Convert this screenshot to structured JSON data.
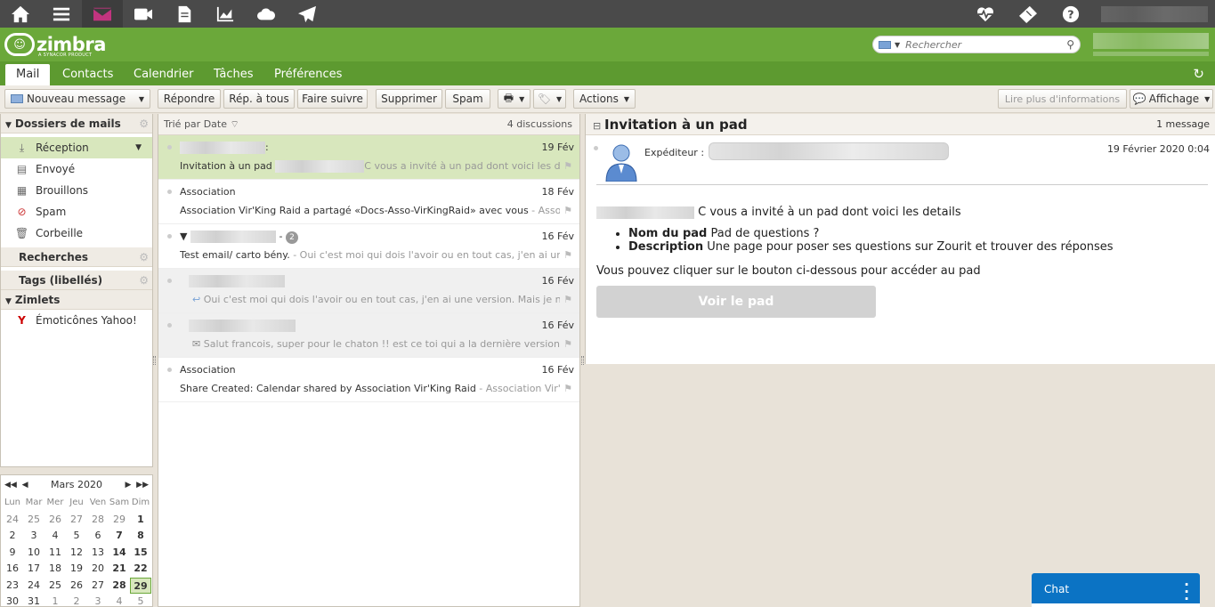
{
  "search": {
    "placeholder": "Rechercher"
  },
  "tabs": [
    {
      "label": "Mail"
    },
    {
      "label": "Contacts"
    },
    {
      "label": "Calendrier"
    },
    {
      "label": "Tâches"
    },
    {
      "label": "Préférences"
    }
  ],
  "toolbar": {
    "new_message": "Nouveau message",
    "reply": "Répondre",
    "reply_all": "Rép. à tous",
    "forward": "Faire suivre",
    "delete": "Supprimer",
    "spam": "Spam",
    "actions": "Actions",
    "read_more": "Lire plus d'informations",
    "view": "Affichage"
  },
  "sidebar": {
    "mail_folders": "Dossiers de mails",
    "folders": [
      {
        "label": "Réception"
      },
      {
        "label": "Envoyé"
      },
      {
        "label": "Brouillons"
      },
      {
        "label": "Spam"
      },
      {
        "label": "Corbeille"
      }
    ],
    "searches": "Recherches",
    "tags": "Tags (libellés)",
    "zimlets": "Zimlets",
    "zimlet_item": "Émoticônes Yahoo!"
  },
  "calendar": {
    "month": "Mars 2020",
    "dow": [
      "Lun",
      "Mar",
      "Mer",
      "Jeu",
      "Ven",
      "Sam",
      "Dim"
    ],
    "weeks": [
      [
        "24",
        "25",
        "26",
        "27",
        "28",
        "29",
        "1"
      ],
      [
        "2",
        "3",
        "4",
        "5",
        "6",
        "7",
        "8"
      ],
      [
        "9",
        "10",
        "11",
        "12",
        "13",
        "14",
        "15"
      ],
      [
        "16",
        "17",
        "18",
        "19",
        "20",
        "21",
        "22"
      ],
      [
        "23",
        "24",
        "25",
        "26",
        "27",
        "28",
        "29"
      ],
      [
        "30",
        "31",
        "1",
        "2",
        "3",
        "4",
        "5"
      ]
    ]
  },
  "list": {
    "sort": "Trié par Date",
    "count": "4 discussions",
    "messages": [
      {
        "from": "",
        "date": "19 Fév",
        "subject": "Invitation à un pad",
        "fragment": "C vous a invité à un pad dont voici les de"
      },
      {
        "from": "Association",
        "date": "18 Fév",
        "subject": "Association Vir'King Raid a partagé «Docs-Asso-VirKingRaid» avec vous",
        "fragment": " - Asso"
      },
      {
        "from": "- ",
        "date": "16 Fév",
        "subject": "Test email/ carto bény.",
        "fragment": " - Oui c'est moi qui dois l'avoir ou en tout cas, j'en ai une"
      },
      {
        "from": "",
        "date": "16 Fév",
        "subject": "",
        "fragment": "Oui c'est moi qui dois l'avoir ou en tout cas, j'en ai une version. Mais je n"
      },
      {
        "from": "",
        "date": "16 Fév",
        "subject": "",
        "fragment": "Salut francois, super pour le chaton !! est ce toi qui a la dernière version"
      },
      {
        "from": "Association",
        "date": "16 Fév",
        "subject": "Share Created: Calendar shared by Association Vir'King Raid",
        "fragment": " - Association Vir'K"
      }
    ],
    "thread_count": "2"
  },
  "reading": {
    "title": "Invitation à un pad",
    "msg_count": "1 message",
    "sender_label": "Expéditeur :",
    "date": "19 Février 2020 0:04",
    "intro": "C vous a invité à un pad dont voici les details",
    "items": [
      {
        "key": "Nom du pad",
        "value": " Pad de questions ?"
      },
      {
        "key": "Description",
        "value": " Une page pour poser ses questions sur Zourit et trouver des réponses"
      }
    ],
    "instruction": "Vous pouvez cliquer sur le bouton ci-dessous pour accéder au pad",
    "button": "Voir le pad"
  },
  "chat": {
    "label": "Chat"
  },
  "colors": {
    "brand_green": "#6ba83a",
    "accent_magenta": "#c2347f",
    "chat_blue": "#0b73c4"
  }
}
